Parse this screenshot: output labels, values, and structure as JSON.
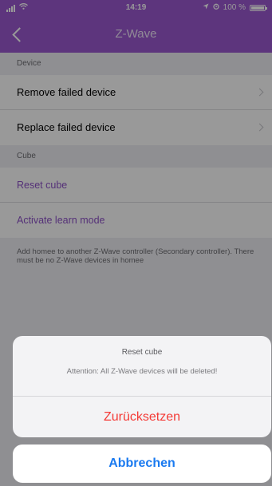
{
  "status_bar": {
    "time": "14:19",
    "battery": "100 %",
    "wifi_icon": "wifi-icon",
    "location_icon": "location-arrow-icon",
    "alarm_icon": "alarm-icon"
  },
  "nav": {
    "title": "Z-Wave",
    "back_icon": "chevron-left-icon"
  },
  "sections": {
    "device": {
      "header": "Device",
      "items": [
        {
          "label": "Remove failed device"
        },
        {
          "label": "Replace failed device"
        }
      ]
    },
    "cube": {
      "header": "Cube",
      "items": [
        {
          "label": "Reset cube"
        },
        {
          "label": "Activate learn mode"
        }
      ],
      "footnote": "Add homee to another Z-Wave controller (Secondary controller). There must be no Z-Wave devices in homee"
    }
  },
  "action_sheet": {
    "title": "Reset cube",
    "message": "Attention: All Z-Wave devices will be deleted!",
    "destructive_label": "Zurücksetzen",
    "cancel_label": "Abbrechen"
  },
  "colors": {
    "brand": "#9b59d1",
    "accent_text": "#8e52c9",
    "destructive": "#f43a36",
    "cancel": "#1a7af0"
  }
}
